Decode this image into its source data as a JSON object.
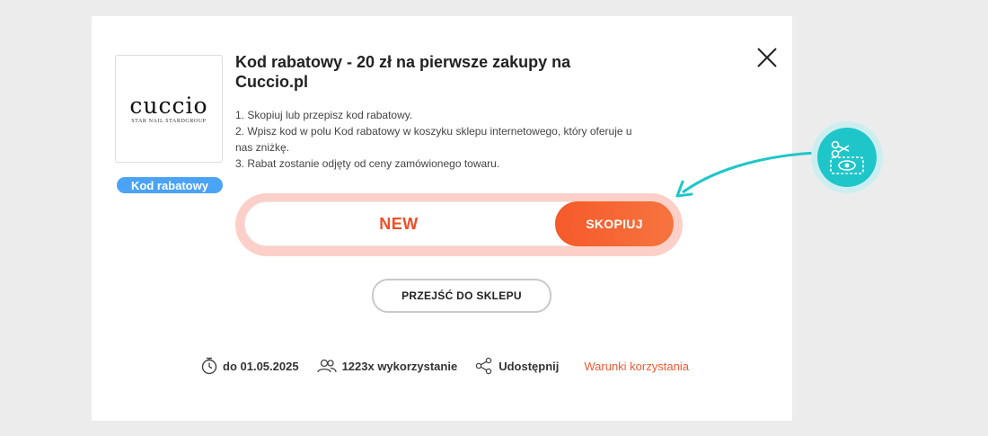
{
  "brand": {
    "logo_word": "cuccio",
    "logo_sub": "STAR NAIL STARDGROUP"
  },
  "offer": {
    "type_badge": "Kod rabatowy",
    "title": "Kod rabatowy - 20 zł na pierwsze zakupy na Cuccio.pl",
    "instructions": [
      "1. Skopiuj lub przepisz kod rabatowy.",
      "2. Wpisz kod w polu Kod rabatowy w koszyku sklepu internetowego, który oferuje u nas zniżkę.",
      "3. Rabat zostanie odjęty od ceny zamówionego towaru."
    ]
  },
  "code": {
    "value": "NEW",
    "copy_label": "SKOPIUJ"
  },
  "shop_button": {
    "label": "PRZEJŚĆ DO SKLEPU"
  },
  "meta": {
    "expiry": "do 01.05.2025",
    "usage": "1223x wykorzystanie",
    "share": "Udostępnij",
    "terms": "Warunki korzystania"
  },
  "icons": {
    "close": "close-icon",
    "clock": "stopwatch-icon",
    "users": "users-icon",
    "share": "share-icon",
    "scissors": "scissors-coupon-icon"
  },
  "colors": {
    "accent": "#f05a30",
    "code_glow": "#fcd0c8",
    "badge": "#4aa3f5",
    "floating": "#1ec6c9",
    "background": "#ececec"
  }
}
